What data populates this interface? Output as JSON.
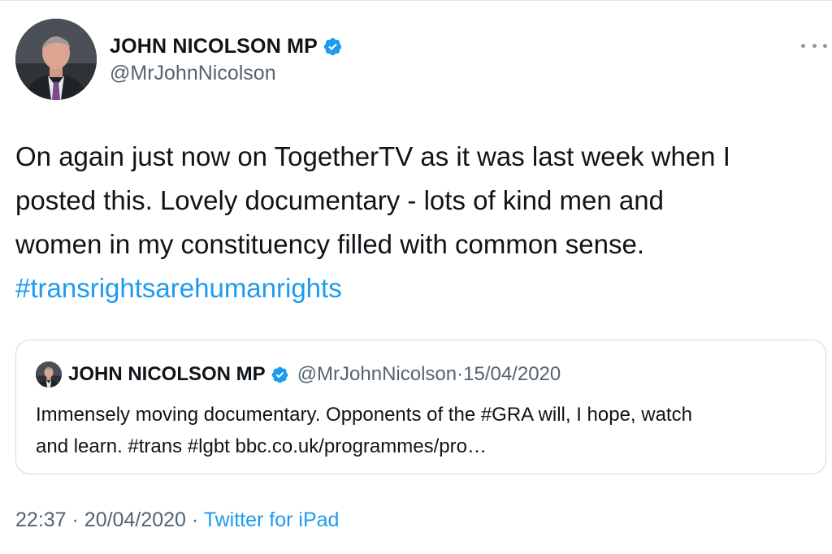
{
  "tweet": {
    "author": {
      "name": "JOHN NICOLSON MP",
      "handle": "@MrJohnNicolson",
      "verified": true,
      "avatar_icon": "profile-photo"
    },
    "text_lines": [
      "On again just now on TogetherTV as it was last week when I",
      "posted this. Lovely documentary - lots of kind men and",
      "women in my constituency filled with common sense."
    ],
    "hashtag": "#transrightsarehumanrights",
    "time": "22:37",
    "separator": "·",
    "date": "20/04/2020",
    "source": "Twitter for iPad"
  },
  "quote": {
    "author": {
      "name": "JOHN NICOLSON MP",
      "handle": "@MrJohnNicolson",
      "verified": true
    },
    "date": "15/04/2020",
    "separator": "·",
    "text_line1": "Immensely moving documentary. Opponents of the #GRA will, I hope, watch",
    "text_line2": "and learn. #trans #lgbt  bbc.co.uk/programmes/pro…"
  },
  "colors": {
    "accent": "#1d9bf0",
    "text": "#0f1419",
    "secondary": "#536471",
    "border": "#cfd9de"
  },
  "icons": {
    "verified": "verified-badge-icon",
    "more": "more-options-icon"
  }
}
